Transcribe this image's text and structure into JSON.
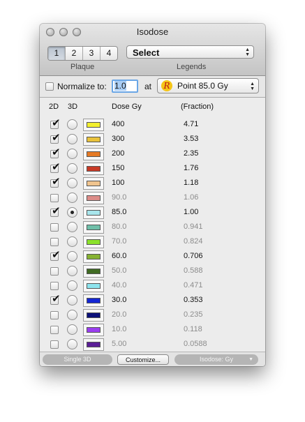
{
  "window": {
    "title": "Isodose"
  },
  "plaque": {
    "tabs": [
      "1",
      "2",
      "3",
      "4"
    ],
    "selected_index": 0,
    "caption": "Plaque"
  },
  "legends": {
    "value": "Select",
    "caption": "Legends"
  },
  "normalize": {
    "checked": false,
    "label": "Normalize to:",
    "value": "1.0",
    "at_label": "at",
    "point_value": "Point 85.0 Gy",
    "point_icon": "rx-icon"
  },
  "table": {
    "headers": {
      "col_2d": "2D",
      "col_3d": "3D",
      "dose": "Dose Gy",
      "fraction": "(Fraction)"
    },
    "rows": [
      {
        "dose": "400",
        "fraction": "4.71",
        "checked_2d": true,
        "selected_3d": false,
        "enabled": true,
        "color": "#f2ef2e"
      },
      {
        "dose": "300",
        "fraction": "3.53",
        "checked_2d": true,
        "selected_3d": false,
        "enabled": true,
        "color": "#e9c23a"
      },
      {
        "dose": "200",
        "fraction": "2.35",
        "checked_2d": true,
        "selected_3d": false,
        "enabled": true,
        "color": "#e57a25"
      },
      {
        "dose": "150",
        "fraction": "1.76",
        "checked_2d": true,
        "selected_3d": false,
        "enabled": true,
        "color": "#c83a26"
      },
      {
        "dose": "100",
        "fraction": "1.18",
        "checked_2d": true,
        "selected_3d": false,
        "enabled": true,
        "color": "#f0c48e"
      },
      {
        "dose": "90.0",
        "fraction": "1.06",
        "checked_2d": false,
        "selected_3d": false,
        "enabled": false,
        "color": "#dc8c88"
      },
      {
        "dose": "85.0",
        "fraction": "1.00",
        "checked_2d": true,
        "selected_3d": true,
        "enabled": true,
        "color": "#a8e6ec"
      },
      {
        "dose": "80.0",
        "fraction": "0.941",
        "checked_2d": false,
        "selected_3d": false,
        "enabled": false,
        "color": "#6fbfa9"
      },
      {
        "dose": "70.0",
        "fraction": "0.824",
        "checked_2d": false,
        "selected_3d": false,
        "enabled": false,
        "color": "#8be22a"
      },
      {
        "dose": "60.0",
        "fraction": "0.706",
        "checked_2d": true,
        "selected_3d": false,
        "enabled": true,
        "color": "#86b232"
      },
      {
        "dose": "50.0",
        "fraction": "0.588",
        "checked_2d": false,
        "selected_3d": false,
        "enabled": false,
        "color": "#3f6a22"
      },
      {
        "dose": "40.0",
        "fraction": "0.471",
        "checked_2d": false,
        "selected_3d": false,
        "enabled": false,
        "color": "#8de4ee"
      },
      {
        "dose": "30.0",
        "fraction": "0.353",
        "checked_2d": true,
        "selected_3d": false,
        "enabled": true,
        "color": "#1326d4"
      },
      {
        "dose": "20.0",
        "fraction": "0.235",
        "checked_2d": false,
        "selected_3d": false,
        "enabled": false,
        "color": "#0c117a"
      },
      {
        "dose": "10.0",
        "fraction": "0.118",
        "checked_2d": false,
        "selected_3d": false,
        "enabled": false,
        "color": "#9b3ef0"
      },
      {
        "dose": "5.00",
        "fraction": "0.0588",
        "checked_2d": false,
        "selected_3d": false,
        "enabled": false,
        "color": "#5a1e96"
      }
    ]
  },
  "footer": {
    "single3d": "Single 3D",
    "customize": "Customize...",
    "isodose_units": "Isodose: Gy"
  }
}
